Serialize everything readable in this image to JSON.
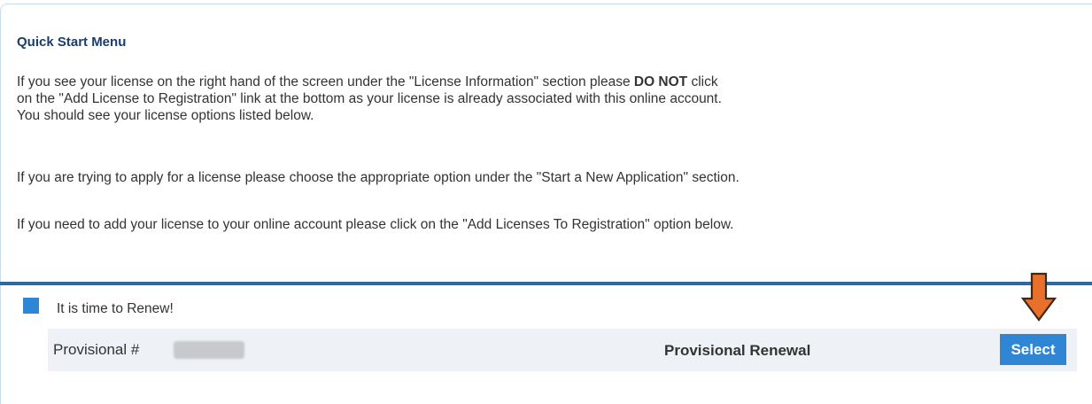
{
  "quick_start": {
    "title": "Quick Start Menu",
    "para1_line1_before": "If you see your license on the right hand of the screen under the \"License Information\" section please ",
    "para1_bold": "DO NOT",
    "para1_line1_after": " click",
    "para1_line2": "on the \"Add License to Registration\" link at the bottom as your license is already associated with this online account.",
    "para1_line3": "You should see your license options listed below.",
    "para2": "If you are trying to apply for a license please choose the appropriate option under the \"Start a New Application\" section.",
    "para3": "If you need to add your license to your online account please click on the \"Add Licenses To Registration\" option below."
  },
  "renewal": {
    "status_text": "It is time to Renew!",
    "status_color": "#2f86d4",
    "license_label": "Provisional #",
    "renewal_type": "Provisional Renewal",
    "select_label": "Select"
  },
  "colors": {
    "accent": "#2f86d4",
    "rule": "#2e6a9e",
    "arrow": "#e8702a",
    "title": "#1a3c6e"
  }
}
